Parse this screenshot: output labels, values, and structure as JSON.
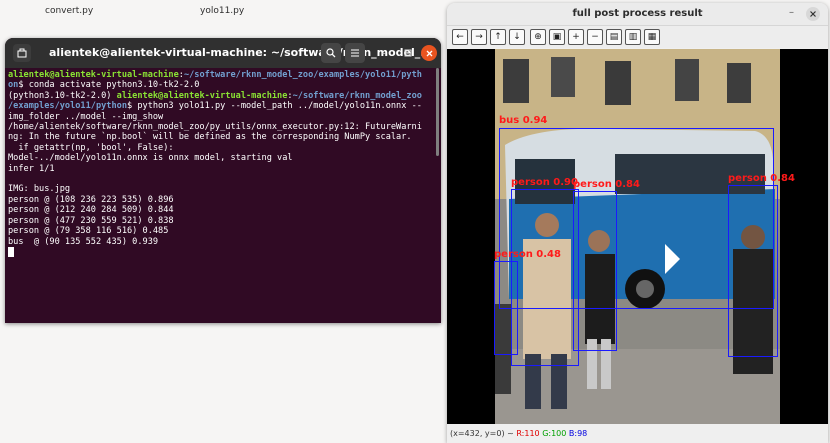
{
  "desktop": {
    "files": [
      "convert.py",
      "yolo11.py"
    ]
  },
  "terminal": {
    "title": "alientek@alientek-virtual-machine: ~/software/rknn_model_...",
    "lines": [
      [
        {
          "t": "alientek@alientek-virtual-machine",
          "c": "u"
        },
        {
          "t": ":",
          "c": "n"
        },
        {
          "t": "~/software/rknn_model_zoo/examples/yolo11/pyth",
          "c": "p"
        }
      ],
      [
        {
          "t": "on",
          "c": "p"
        },
        {
          "t": "$ conda activate python3.10-tk2-2.0",
          "c": "n"
        }
      ],
      [
        {
          "t": "(python3.10-tk2-2.0) ",
          "c": "n"
        },
        {
          "t": "alientek@alientek-virtual-machine",
          "c": "u"
        },
        {
          "t": ":",
          "c": "n"
        },
        {
          "t": "~/software/rknn_model_zoo",
          "c": "p"
        }
      ],
      [
        {
          "t": "/examples/yolo11/python",
          "c": "p"
        },
        {
          "t": "$ python3 yolo11.py --model_path ../model/yolo11n.onnx --",
          "c": "n"
        }
      ],
      [
        {
          "t": "img_folder ../model --img_show",
          "c": "n"
        }
      ],
      [
        {
          "t": "/home/alientek/software/rknn_model_zoo/py_utils/onnx_executor.py:12: FutureWarni",
          "c": "n"
        }
      ],
      [
        {
          "t": "ng: In the future `np.bool` will be defined as the corresponding NumPy scalar.",
          "c": "n"
        }
      ],
      [
        {
          "t": "  if getattr(np, 'bool', False):",
          "c": "n"
        }
      ],
      [
        {
          "t": "Model-../model/yolo11n.onnx is onnx model, starting val",
          "c": "n"
        }
      ],
      [
        {
          "t": "infer 1/1",
          "c": "n"
        }
      ],
      [
        {
          "t": "",
          "c": "n"
        }
      ],
      [
        {
          "t": "IMG: bus.jpg",
          "c": "n"
        }
      ],
      [
        {
          "t": "person @ (108 236 223 535) 0.896",
          "c": "n"
        }
      ],
      [
        {
          "t": "person @ (212 240 284 509) 0.844",
          "c": "n"
        }
      ],
      [
        {
          "t": "person @ (477 230 559 521) 0.838",
          "c": "n"
        }
      ],
      [
        {
          "t": "person @ (79 358 116 516) 0.485",
          "c": "n"
        }
      ],
      [
        {
          "t": "bus  @ (90 135 552 435) 0.939",
          "c": "n"
        }
      ]
    ]
  },
  "result": {
    "title": "full post process result",
    "status": {
      "coords": "(x=432, y=0) ~",
      "r": "R:110",
      "g": "G:100",
      "b": "B:98"
    },
    "detections": [
      {
        "label": "bus  0.94"
      },
      {
        "label": "person 0.90"
      },
      {
        "label": "person 0.84"
      },
      {
        "label": "person 0.84"
      },
      {
        "label": "person 0.48"
      }
    ]
  },
  "colors": {
    "terminal_bg": "#300a24",
    "prompt_user": "#8ae234",
    "prompt_path": "#729fcf",
    "box": "#1a1aff",
    "label": "#ff1a1a"
  }
}
